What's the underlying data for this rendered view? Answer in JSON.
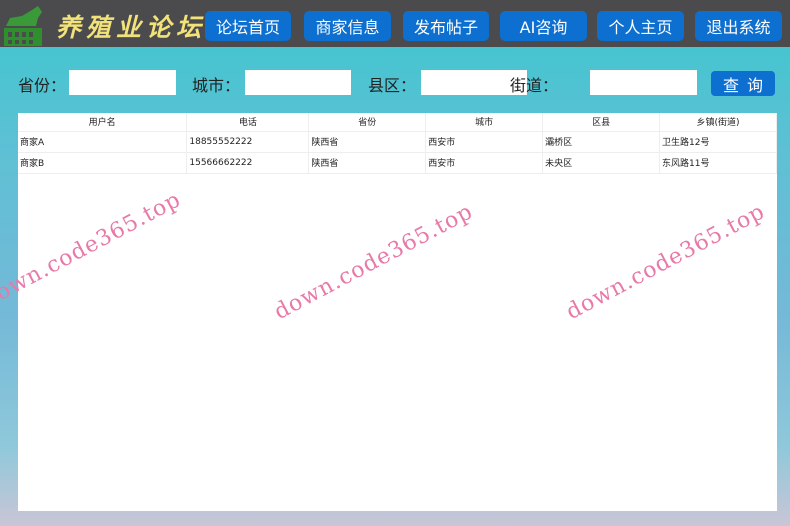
{
  "header": {
    "title": "养殖业论坛",
    "nav": [
      "论坛首页",
      "商家信息",
      "发布帖子",
      "AI咨询",
      "个人主页",
      "退出系统"
    ]
  },
  "search": {
    "province_label": "省份：",
    "city_label": "城市：",
    "county_label": "县区：",
    "street_label": "街道：",
    "province_value": "",
    "city_value": "",
    "county_value": "",
    "street_value": "",
    "query_button": "查询"
  },
  "table": {
    "columns": [
      "用户名",
      "电话",
      "省份",
      "城市",
      "区县",
      "乡镇(街道)"
    ],
    "rows": [
      [
        "商家A",
        "18855552222",
        "陕西省",
        "西安市",
        "灞桥区",
        "卫生路12号"
      ],
      [
        "商家B",
        "15566662222",
        "陕西省",
        "西安市",
        "未央区",
        "东风路11号"
      ]
    ]
  },
  "watermark": "down.code365.top"
}
